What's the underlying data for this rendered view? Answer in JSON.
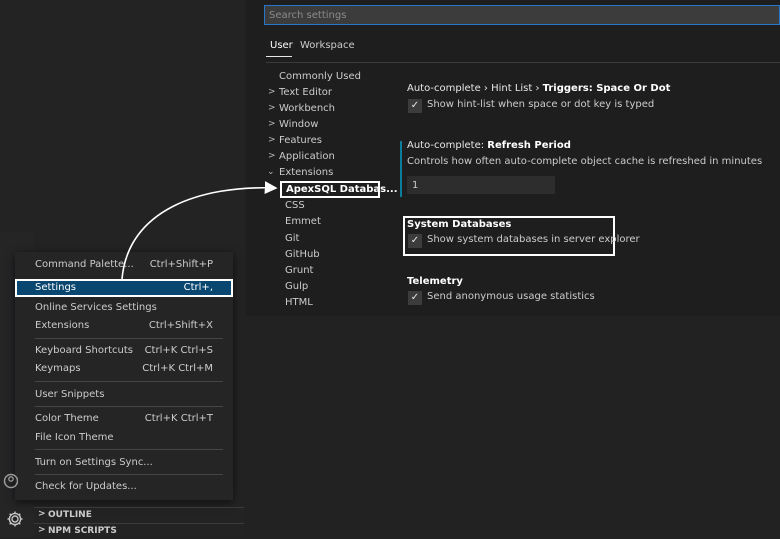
{
  "search": {
    "placeholder": "Search settings"
  },
  "tabs": [
    {
      "label": "User"
    },
    {
      "label": "Workspace"
    }
  ],
  "tree": {
    "items": [
      {
        "label": "Commonly Used"
      },
      {
        "label": "Text Editor"
      },
      {
        "label": "Workbench"
      },
      {
        "label": "Window"
      },
      {
        "label": "Features"
      },
      {
        "label": "Application"
      },
      {
        "label": "Extensions"
      }
    ],
    "selected": "ApexSQL Databas...",
    "extensions": [
      {
        "label": "CSS"
      },
      {
        "label": "Emmet"
      },
      {
        "label": "Git"
      },
      {
        "label": "GitHub"
      },
      {
        "label": "Grunt"
      },
      {
        "label": "Gulp"
      },
      {
        "label": "HTML"
      }
    ]
  },
  "settings": {
    "autocomplete_hint": {
      "title_prefix": "Auto-complete › Hint List › ",
      "title_name": "Triggers: Space Or Dot",
      "checkbox_label": "Show hint-list when space or dot key is typed"
    },
    "refresh_period": {
      "title_prefix": "Auto-complete: ",
      "title_name": "Refresh Period",
      "description": "Controls how often auto-complete object cache is refreshed in minutes",
      "value": "1"
    },
    "system_databases": {
      "title": "System Databases",
      "checkbox_label": "Show system databases in server explorer"
    },
    "telemetry": {
      "title": "Telemetry",
      "checkbox_label": "Send anonymous usage statistics"
    },
    "check_glyph": "✓"
  },
  "menu": {
    "items": [
      {
        "label": "Command Palette...",
        "shortcut": "Ctrl+Shift+P"
      },
      {
        "label": "Settings",
        "shortcut": "Ctrl+,"
      },
      {
        "label": "Online Services Settings",
        "shortcut": ""
      },
      {
        "label": "Extensions",
        "shortcut": "Ctrl+Shift+X"
      },
      {
        "label": "Keyboard Shortcuts",
        "shortcut": "Ctrl+K Ctrl+S"
      },
      {
        "label": "Keymaps",
        "shortcut": "Ctrl+K Ctrl+M"
      },
      {
        "label": "User Snippets",
        "shortcut": ""
      },
      {
        "label": "Color Theme",
        "shortcut": "Ctrl+K Ctrl+T"
      },
      {
        "label": "File Icon Theme",
        "shortcut": ""
      },
      {
        "label": "Turn on Settings Sync...",
        "shortcut": ""
      },
      {
        "label": "Check for Updates...",
        "shortcut": ""
      }
    ]
  },
  "bottom_panels": [
    {
      "label": "OUTLINE"
    },
    {
      "label": "NPM SCRIPTS"
    }
  ],
  "colors": {
    "accent": "#094771",
    "focus_border": "#2677c9",
    "modified_indicator": "#0c7d9d",
    "highlight": "#ffffff"
  },
  "icons": [
    "gear-icon",
    "account-icon",
    "chevron-right-icon",
    "chevron-down-icon",
    "check-icon"
  ]
}
